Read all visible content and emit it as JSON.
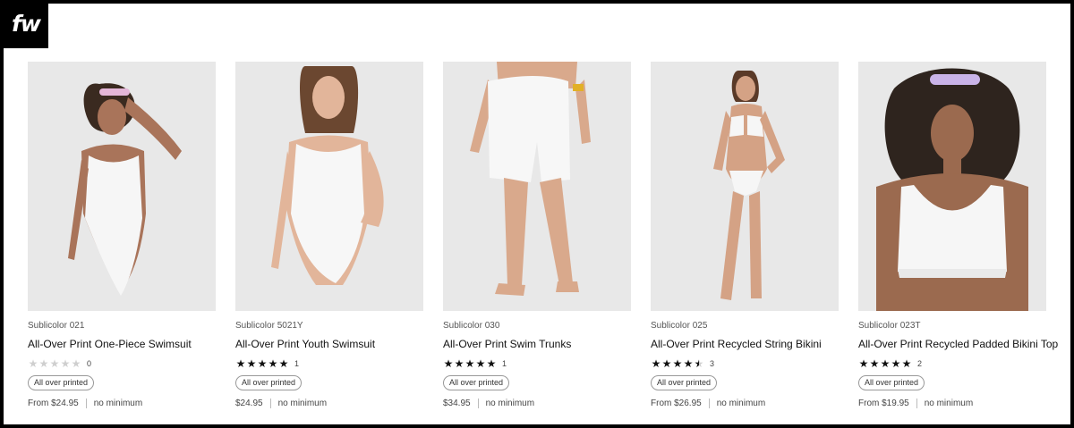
{
  "brand": {
    "logo_text": "fw"
  },
  "products": [
    {
      "sku": "Sublicolor 021",
      "title": "All-Over Print One-Piece Swimsuit",
      "rating": 0,
      "review_count": "0",
      "badge": "All over printed",
      "price": "From $24.95",
      "minimum": "no minimum",
      "image": "model-one-piece-swimsuit"
    },
    {
      "sku": "Sublicolor 5021Y",
      "title": "All-Over Print Youth Swimsuit",
      "rating": 5,
      "review_count": "1",
      "badge": "All over printed",
      "price": "$24.95",
      "minimum": "no minimum",
      "image": "model-youth-swimsuit"
    },
    {
      "sku": "Sublicolor 030",
      "title": "All-Over Print Swim Trunks",
      "rating": 5,
      "review_count": "1",
      "badge": "All over printed",
      "price": "$34.95",
      "minimum": "no minimum",
      "image": "model-swim-trunks"
    },
    {
      "sku": "Sublicolor 025",
      "title": "All-Over Print Recycled String Bikini",
      "rating": 4.5,
      "review_count": "3",
      "badge": "All over printed",
      "price": "From $26.95",
      "minimum": "no minimum",
      "image": "model-string-bikini"
    },
    {
      "sku": "Sublicolor 023T",
      "title": "All-Over Print Recycled Padded Bikini Top",
      "rating": 5,
      "review_count": "2",
      "badge": "All over printed",
      "price": "From $19.95",
      "minimum": "no minimum",
      "image": "model-padded-bikini-top"
    }
  ],
  "colors": {
    "star_filled": "#111111",
    "star_empty": "#cfcfcf",
    "photo_bg": "#e8e8e8"
  }
}
